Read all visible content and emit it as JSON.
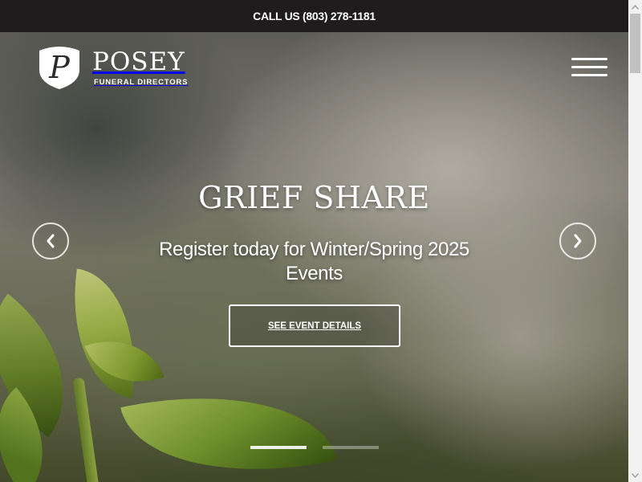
{
  "topbar": {
    "call_text": "CALL US (803) 278-1181"
  },
  "logo": {
    "letter": "P",
    "name": "POSEY",
    "tagline": "FUNERAL DIRECTORS"
  },
  "header": {
    "menu_icon": "hamburger-menu-icon"
  },
  "slider": {
    "title": "GRIEF SHARE",
    "subtitle": "Register today for Winter/Spring 2025 Events",
    "button_label": "SEE EVENT DETAILS",
    "prev_icon": "chevron-left-icon",
    "next_icon": "chevron-right-icon",
    "slide_count": 2,
    "active_slide": 1
  },
  "colors": {
    "topbar_bg": "#1e1c1c",
    "text": "#ffffff",
    "scrollbar_track": "#f1f1f1",
    "scrollbar_thumb": "#c1c1c1"
  }
}
